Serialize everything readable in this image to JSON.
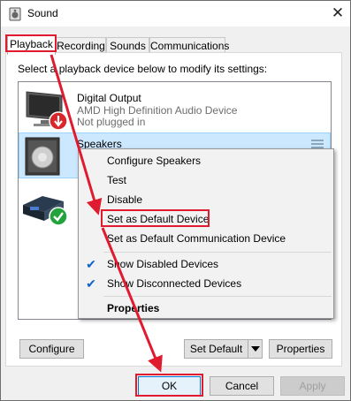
{
  "window": {
    "title": "Sound",
    "close_symbol": "✕"
  },
  "tabs": [
    {
      "label": "Playback",
      "active": true
    },
    {
      "label": "Recording",
      "active": false
    },
    {
      "label": "Sounds",
      "active": false
    },
    {
      "label": "Communications",
      "active": false
    }
  ],
  "instructions": "Select a playback device below to modify its settings:",
  "devices": [
    {
      "name": "Digital Output",
      "line2": "AMD High Definition Audio Device",
      "line3": "Not plugged in"
    },
    {
      "name": "Speakers"
    }
  ],
  "context_menu": {
    "items": [
      {
        "label": "Configure Speakers"
      },
      {
        "label": "Test"
      },
      {
        "label": "Disable"
      },
      {
        "label": "Set as Default Device"
      },
      {
        "label": "Set as Default Communication Device"
      },
      {
        "label": "Show Disabled Devices",
        "checked": true
      },
      {
        "label": "Show Disconnected Devices",
        "checked": true
      },
      {
        "label": "Properties"
      }
    ],
    "check_symbol": "✔"
  },
  "panel_buttons": {
    "configure": "Configure",
    "set_default": "Set Default",
    "properties": "Properties"
  },
  "dialog_buttons": {
    "ok": "OK",
    "cancel": "Cancel",
    "apply": "Apply"
  },
  "colors": {
    "annotation_red": "#e01b2f",
    "selection_blue": "#cce8ff",
    "check_blue": "#0a64c8"
  }
}
